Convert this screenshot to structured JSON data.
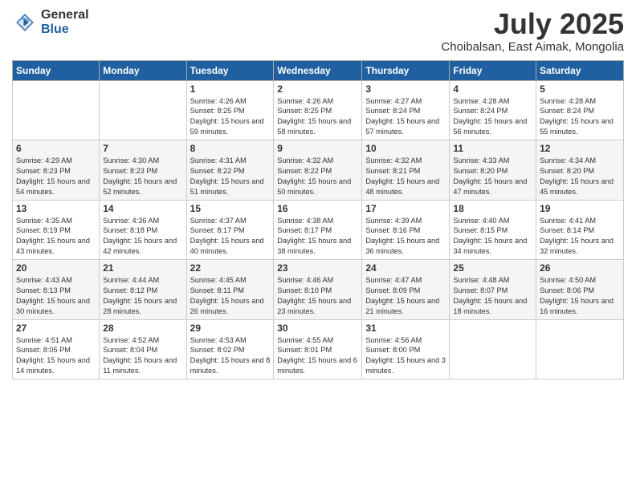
{
  "header": {
    "logo_general": "General",
    "logo_blue": "Blue",
    "title": "July 2025",
    "location": "Choibalsan, East Aimak, Mongolia"
  },
  "weekdays": [
    "Sunday",
    "Monday",
    "Tuesday",
    "Wednesday",
    "Thursday",
    "Friday",
    "Saturday"
  ],
  "weeks": [
    [
      {
        "day": "",
        "info": ""
      },
      {
        "day": "",
        "info": ""
      },
      {
        "day": "1",
        "info": "Sunrise: 4:26 AM\nSunset: 8:25 PM\nDaylight: 15 hours and 59 minutes."
      },
      {
        "day": "2",
        "info": "Sunrise: 4:26 AM\nSunset: 8:25 PM\nDaylight: 15 hours and 58 minutes."
      },
      {
        "day": "3",
        "info": "Sunrise: 4:27 AM\nSunset: 8:24 PM\nDaylight: 15 hours and 57 minutes."
      },
      {
        "day": "4",
        "info": "Sunrise: 4:28 AM\nSunset: 8:24 PM\nDaylight: 15 hours and 56 minutes."
      },
      {
        "day": "5",
        "info": "Sunrise: 4:28 AM\nSunset: 8:24 PM\nDaylight: 15 hours and 55 minutes."
      }
    ],
    [
      {
        "day": "6",
        "info": "Sunrise: 4:29 AM\nSunset: 8:23 PM\nDaylight: 15 hours and 54 minutes."
      },
      {
        "day": "7",
        "info": "Sunrise: 4:30 AM\nSunset: 8:23 PM\nDaylight: 15 hours and 52 minutes."
      },
      {
        "day": "8",
        "info": "Sunrise: 4:31 AM\nSunset: 8:22 PM\nDaylight: 15 hours and 51 minutes."
      },
      {
        "day": "9",
        "info": "Sunrise: 4:32 AM\nSunset: 8:22 PM\nDaylight: 15 hours and 50 minutes."
      },
      {
        "day": "10",
        "info": "Sunrise: 4:32 AM\nSunset: 8:21 PM\nDaylight: 15 hours and 48 minutes."
      },
      {
        "day": "11",
        "info": "Sunrise: 4:33 AM\nSunset: 8:20 PM\nDaylight: 15 hours and 47 minutes."
      },
      {
        "day": "12",
        "info": "Sunrise: 4:34 AM\nSunset: 8:20 PM\nDaylight: 15 hours and 45 minutes."
      }
    ],
    [
      {
        "day": "13",
        "info": "Sunrise: 4:35 AM\nSunset: 8:19 PM\nDaylight: 15 hours and 43 minutes."
      },
      {
        "day": "14",
        "info": "Sunrise: 4:36 AM\nSunset: 8:18 PM\nDaylight: 15 hours and 42 minutes."
      },
      {
        "day": "15",
        "info": "Sunrise: 4:37 AM\nSunset: 8:17 PM\nDaylight: 15 hours and 40 minutes."
      },
      {
        "day": "16",
        "info": "Sunrise: 4:38 AM\nSunset: 8:17 PM\nDaylight: 15 hours and 38 minutes."
      },
      {
        "day": "17",
        "info": "Sunrise: 4:39 AM\nSunset: 8:16 PM\nDaylight: 15 hours and 36 minutes."
      },
      {
        "day": "18",
        "info": "Sunrise: 4:40 AM\nSunset: 8:15 PM\nDaylight: 15 hours and 34 minutes."
      },
      {
        "day": "19",
        "info": "Sunrise: 4:41 AM\nSunset: 8:14 PM\nDaylight: 15 hours and 32 minutes."
      }
    ],
    [
      {
        "day": "20",
        "info": "Sunrise: 4:43 AM\nSunset: 8:13 PM\nDaylight: 15 hours and 30 minutes."
      },
      {
        "day": "21",
        "info": "Sunrise: 4:44 AM\nSunset: 8:12 PM\nDaylight: 15 hours and 28 minutes."
      },
      {
        "day": "22",
        "info": "Sunrise: 4:45 AM\nSunset: 8:11 PM\nDaylight: 15 hours and 26 minutes."
      },
      {
        "day": "23",
        "info": "Sunrise: 4:46 AM\nSunset: 8:10 PM\nDaylight: 15 hours and 23 minutes."
      },
      {
        "day": "24",
        "info": "Sunrise: 4:47 AM\nSunset: 8:09 PM\nDaylight: 15 hours and 21 minutes."
      },
      {
        "day": "25",
        "info": "Sunrise: 4:48 AM\nSunset: 8:07 PM\nDaylight: 15 hours and 18 minutes."
      },
      {
        "day": "26",
        "info": "Sunrise: 4:50 AM\nSunset: 8:06 PM\nDaylight: 15 hours and 16 minutes."
      }
    ],
    [
      {
        "day": "27",
        "info": "Sunrise: 4:51 AM\nSunset: 8:05 PM\nDaylight: 15 hours and 14 minutes."
      },
      {
        "day": "28",
        "info": "Sunrise: 4:52 AM\nSunset: 8:04 PM\nDaylight: 15 hours and 11 minutes."
      },
      {
        "day": "29",
        "info": "Sunrise: 4:53 AM\nSunset: 8:02 PM\nDaylight: 15 hours and 8 minutes."
      },
      {
        "day": "30",
        "info": "Sunrise: 4:55 AM\nSunset: 8:01 PM\nDaylight: 15 hours and 6 minutes."
      },
      {
        "day": "31",
        "info": "Sunrise: 4:56 AM\nSunset: 8:00 PM\nDaylight: 15 hours and 3 minutes."
      },
      {
        "day": "",
        "info": ""
      },
      {
        "day": "",
        "info": ""
      }
    ]
  ]
}
